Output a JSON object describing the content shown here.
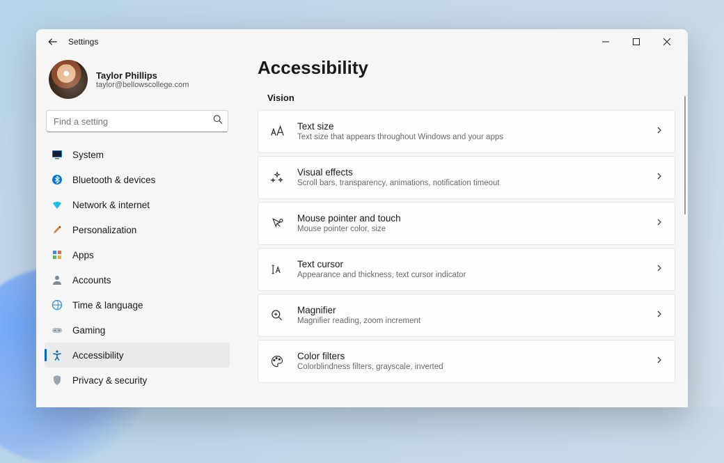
{
  "window": {
    "title": "Settings"
  },
  "profile": {
    "name": "Taylor Phillips",
    "email": "taylor@bellowscollege.com"
  },
  "search": {
    "placeholder": "Find a setting"
  },
  "nav": {
    "items": [
      {
        "label": "System"
      },
      {
        "label": "Bluetooth & devices"
      },
      {
        "label": "Network & internet"
      },
      {
        "label": "Personalization"
      },
      {
        "label": "Apps"
      },
      {
        "label": "Accounts"
      },
      {
        "label": "Time & language"
      },
      {
        "label": "Gaming"
      },
      {
        "label": "Accessibility"
      },
      {
        "label": "Privacy & security"
      }
    ],
    "active_index": 8
  },
  "page": {
    "title": "Accessibility",
    "section": "Vision",
    "items": [
      {
        "title": "Text size",
        "sub": "Text size that appears throughout Windows and your apps"
      },
      {
        "title": "Visual effects",
        "sub": "Scroll bars, transparency, animations, notification timeout"
      },
      {
        "title": "Mouse pointer and touch",
        "sub": "Mouse pointer color, size"
      },
      {
        "title": "Text cursor",
        "sub": "Appearance and thickness, text cursor indicator"
      },
      {
        "title": "Magnifier",
        "sub": "Magnifier reading, zoom increment"
      },
      {
        "title": "Color filters",
        "sub": "Colorblindness filters, grayscale, inverted"
      }
    ]
  },
  "colors": {
    "accent": "#0067c0"
  }
}
